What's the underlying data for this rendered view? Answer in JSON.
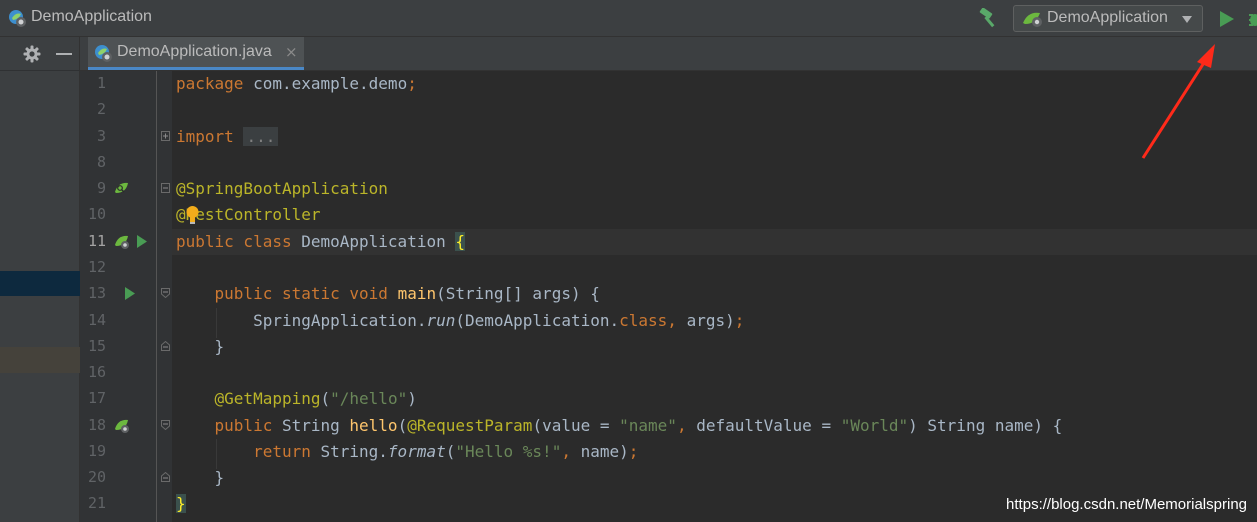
{
  "window": {
    "title": "DemoApplication"
  },
  "toolbar": {
    "run_config": "DemoApplication"
  },
  "tabs": [
    {
      "label": "DemoApplication.java",
      "close": "×"
    }
  ],
  "editor": {
    "current_line": "11",
    "lines": [
      {
        "num": "1",
        "text": "package com.example.demo;"
      },
      {
        "num": "2",
        "text": ""
      },
      {
        "num": "3",
        "text": "import ..."
      },
      {
        "num": "8",
        "text": ""
      },
      {
        "num": "9",
        "text": "@SpringBootApplication"
      },
      {
        "num": "10",
        "text": "@RestController"
      },
      {
        "num": "11",
        "text": "public class DemoApplication {"
      },
      {
        "num": "12",
        "text": ""
      },
      {
        "num": "13",
        "text": "    public static void main(String[] args) {"
      },
      {
        "num": "14",
        "text": "        SpringApplication.run(DemoApplication.class, args);"
      },
      {
        "num": "15",
        "text": "    }"
      },
      {
        "num": "16",
        "text": ""
      },
      {
        "num": "17",
        "text": "    @GetMapping(\"/hello\")"
      },
      {
        "num": "18",
        "text": "    public String hello(@RequestParam(value = \"name\", defaultValue = \"World\") String name) {"
      },
      {
        "num": "19",
        "text": "        return String.format(\"Hello %s!\", name);"
      },
      {
        "num": "20",
        "text": "    }"
      },
      {
        "num": "21",
        "text": "}"
      }
    ]
  },
  "watermark": "https://blog.csdn.net/Memorialspring",
  "colors": {
    "keyword": "#cc7832",
    "annotation": "#bbb529",
    "string": "#6a8759",
    "method": "#ffc66d",
    "text": "#a9b7c6",
    "run_green": "#499c54",
    "annotation_arrow": "#ff2a1a"
  },
  "icons": [
    "spring-app-icon",
    "build-hammer-icon",
    "run-icon",
    "debug-icon",
    "gear-icon",
    "minimize-icon",
    "spring-bean-icon",
    "run-gutter-icon",
    "intention-bulb-icon",
    "fold-icon"
  ]
}
